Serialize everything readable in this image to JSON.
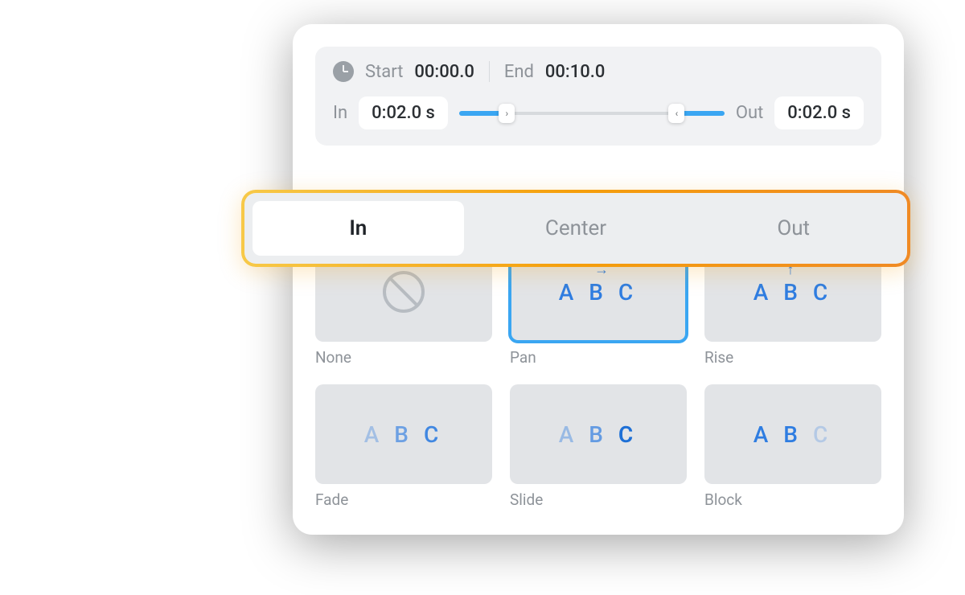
{
  "timing": {
    "start_label": "Start",
    "start_value": "00:00.0",
    "end_label": "End",
    "end_value": "00:10.0",
    "in_label": "In",
    "in_value": "0:02.0 s",
    "out_label": "Out",
    "out_value": "0:02.0 s"
  },
  "tabs": {
    "in": "In",
    "center": "Center",
    "out": "Out",
    "active": "in"
  },
  "effects": [
    {
      "id": "none",
      "label": "None",
      "selected": false
    },
    {
      "id": "pan",
      "label": "Pan",
      "selected": true
    },
    {
      "id": "rise",
      "label": "Rise",
      "selected": false
    },
    {
      "id": "fade",
      "label": "Fade",
      "selected": false
    },
    {
      "id": "slide",
      "label": "Slide",
      "selected": false
    },
    {
      "id": "block",
      "label": "Block",
      "selected": false
    }
  ],
  "preview_text": "A B C"
}
